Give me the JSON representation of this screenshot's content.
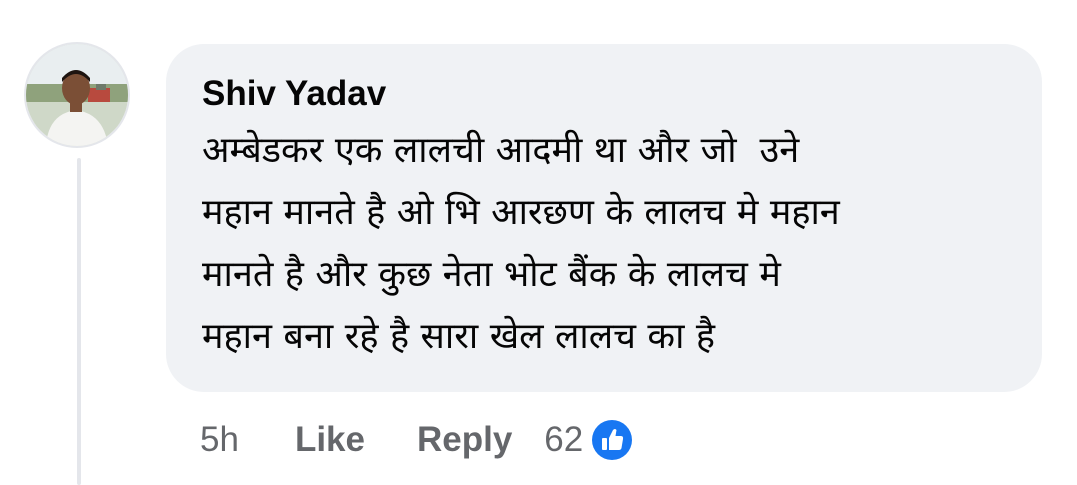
{
  "comment": {
    "author": "Shiv Yadav",
    "text": "अम्बेडकर एक लालची आदमी था और जो  उने\nमहान मानते है ओ भि आरछण के लालच मे महान\nमानते है और कुछ नेता भोट बैंक के लालच मे\nमहान बना रहे है सारा खेल लालच का है",
    "time": "5h",
    "like_label": "Like",
    "reply_label": "Reply",
    "reaction_count": "62",
    "reaction_icon": "like-thumb-icon"
  },
  "colors": {
    "bubble_bg": "#f0f2f5",
    "text": "#050505",
    "secondary_text": "#65676b",
    "like_blue": "#1877f2"
  }
}
